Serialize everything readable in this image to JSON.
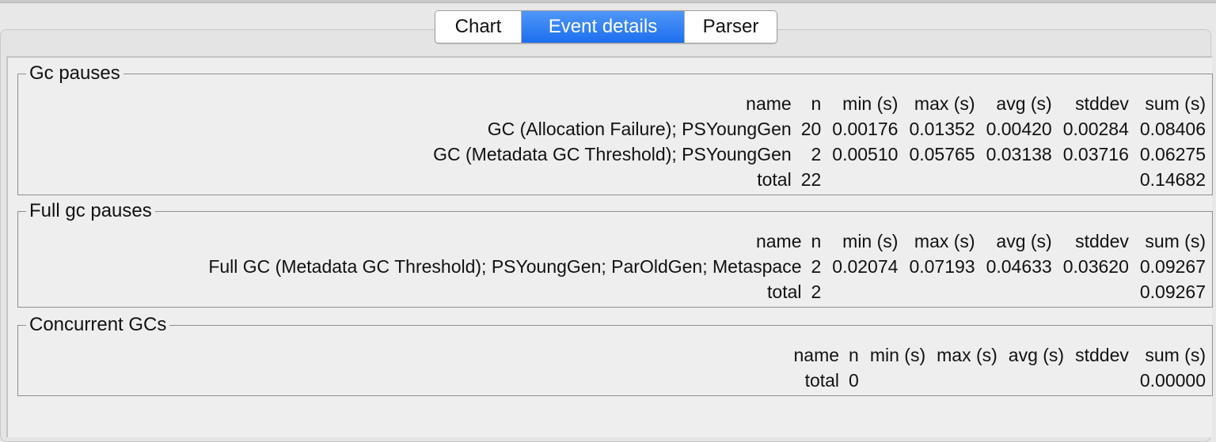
{
  "tabs": [
    {
      "label": "Chart",
      "active": false
    },
    {
      "label": "Event details",
      "active": true
    },
    {
      "label": "Parser",
      "active": false
    }
  ],
  "accent_color": "#2d7cf5",
  "sections": {
    "gc_pauses": {
      "title": "Gc pauses",
      "columns": [
        "name",
        "n",
        "min (s)",
        "max (s)",
        "avg (s)",
        "stddev",
        "sum (s)"
      ],
      "rows": [
        [
          "GC (Allocation Failure); PSYoungGen",
          "20",
          "0.00176",
          "0.01352",
          "0.00420",
          "0.00284",
          "0.08406"
        ],
        [
          "GC (Metadata GC Threshold); PSYoungGen",
          "2",
          "0.00510",
          "0.05765",
          "0.03138",
          "0.03716",
          "0.06275"
        ]
      ],
      "total": [
        "total",
        "22",
        "0.14682"
      ]
    },
    "full_gc_pauses": {
      "title": "Full gc pauses",
      "columns": [
        "name",
        "n",
        "min (s)",
        "max (s)",
        "avg (s)",
        "stddev",
        "sum (s)"
      ],
      "rows": [
        [
          "Full GC (Metadata GC Threshold); PSYoungGen; ParOldGen; Metaspace",
          "2",
          "0.02074",
          "0.07193",
          "0.04633",
          "0.03620",
          "0.09267"
        ]
      ],
      "total": [
        "total",
        "2",
        "0.09267"
      ]
    },
    "concurrent_gcs": {
      "title": "Concurrent GCs",
      "columns": [
        "name",
        "n",
        "min (s)",
        "max (s)",
        "avg (s)",
        "stddev",
        "sum (s)"
      ],
      "rows": [],
      "total": [
        "total",
        "0",
        "0.00000"
      ]
    }
  }
}
